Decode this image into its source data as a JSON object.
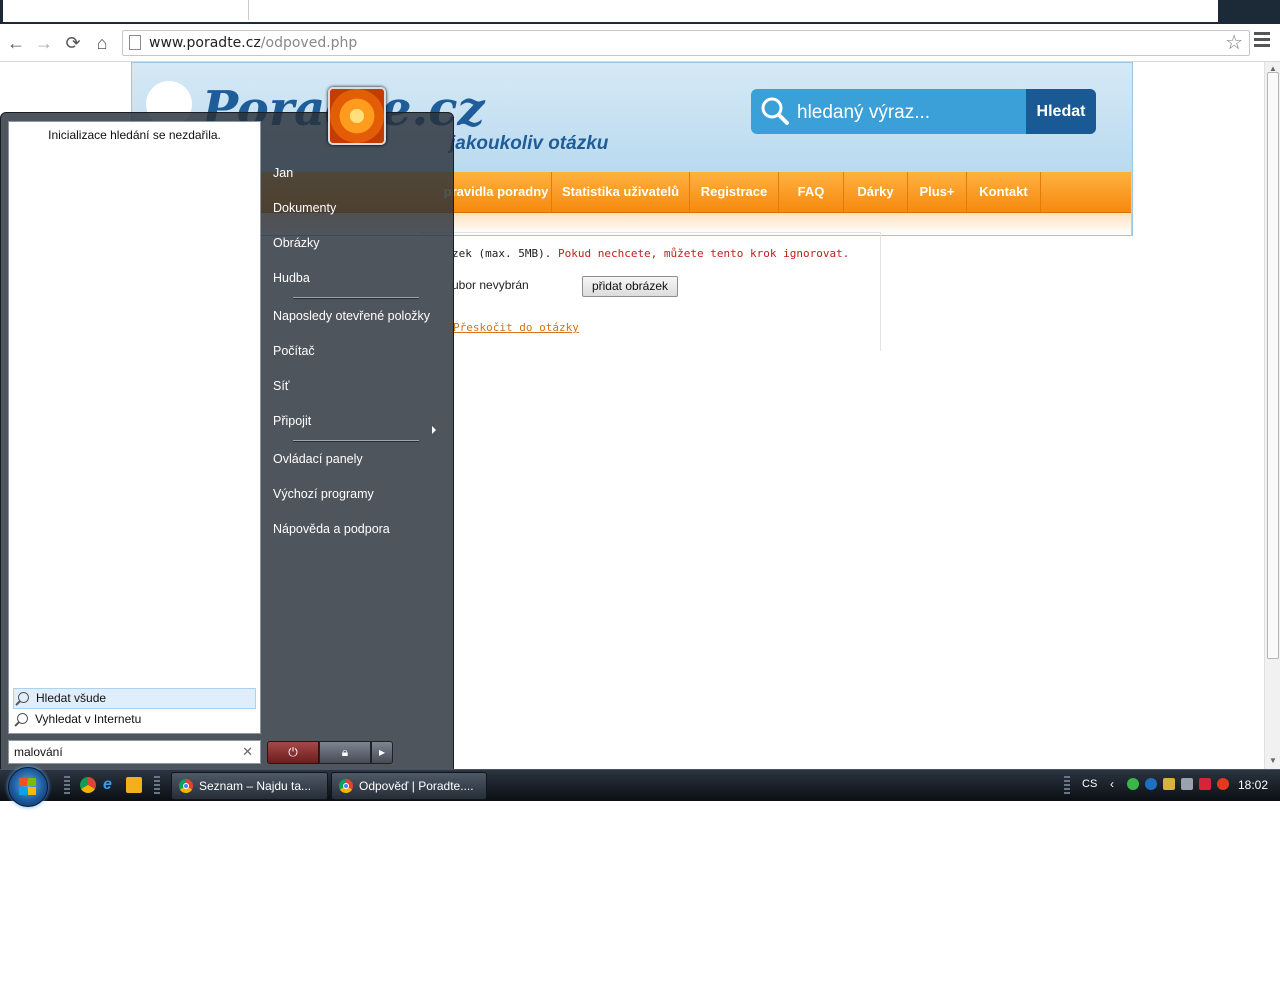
{
  "browser": {
    "url_host": "www.poradte.cz",
    "url_path": "/odpoved.php"
  },
  "page": {
    "logo_text": "Poradte.cz",
    "tagline": "jakoukoliv otázku",
    "search_placeholder": "hledaný výraz...",
    "search_button": "Hledat",
    "nav": [
      "pravidla poradny",
      "Statistika uživatelů",
      "Registrace",
      "FAQ",
      "Dárky",
      "Plus+",
      "Kontakt"
    ],
    "upload_text_black": "zek (max. 5MB).",
    "upload_text_red": "Pokud nechcete, můžete tento krok ignorovat.",
    "file_status": "ubor nevybrán",
    "add_image_button": "přidat obrázek",
    "skip_link": "Přeskočit do otázky"
  },
  "start_menu": {
    "search_failed": "Inicializace hledání se nezdařila.",
    "search_everywhere": "Hledat všude",
    "search_internet": "Vyhledat v Internetu",
    "search_value": "malování",
    "right_items": [
      "Jan",
      "Dokumenty",
      "Obrázky",
      "Hudba",
      "Naposledy otevřené položky",
      "Počítač",
      "Síť",
      "Připojit",
      "Ovládací panely",
      "Výchozí programy",
      "Nápověda a podpora"
    ]
  },
  "taskbar": {
    "tasks": [
      "Seznam – Najdu ta...",
      "Odpověď | Poradte...."
    ],
    "language": "CS",
    "clock": "18:02"
  }
}
